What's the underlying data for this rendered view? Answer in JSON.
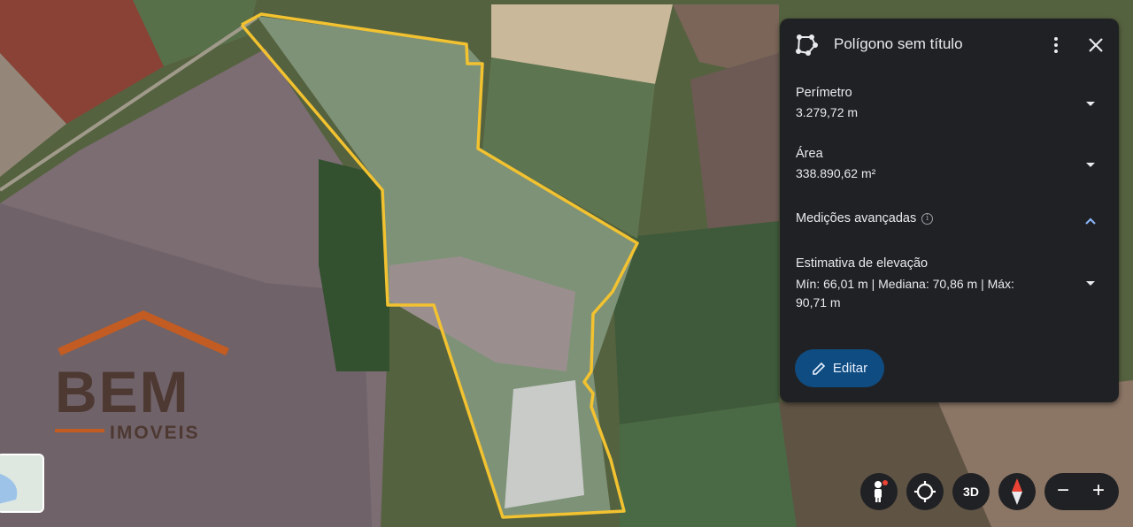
{
  "panel": {
    "title": "Polígono sem título",
    "perimeter_label": "Perímetro",
    "perimeter_value": "3.279,72 m",
    "area_label": "Área",
    "area_value": "338.890,62 m²",
    "advanced_label": "Medições avançadas",
    "elevation_label": "Estimativa de elevação",
    "elevation_line1": "Mín: 66,01 m | Mediana: 70,86 m | Máx:",
    "elevation_line2": "90,71 m",
    "edit_label": "Editar"
  },
  "controls": {
    "3d_label": "3D",
    "zoom_out": "−",
    "zoom_in": "+"
  },
  "watermark": {
    "line1": "BEM",
    "line2": "IMOVEIS"
  },
  "colors": {
    "polygon_outline": "#f2c230",
    "panel_bg": "#202124",
    "edit_button": "#0f4c81",
    "logo_roof": "#c35c22"
  }
}
